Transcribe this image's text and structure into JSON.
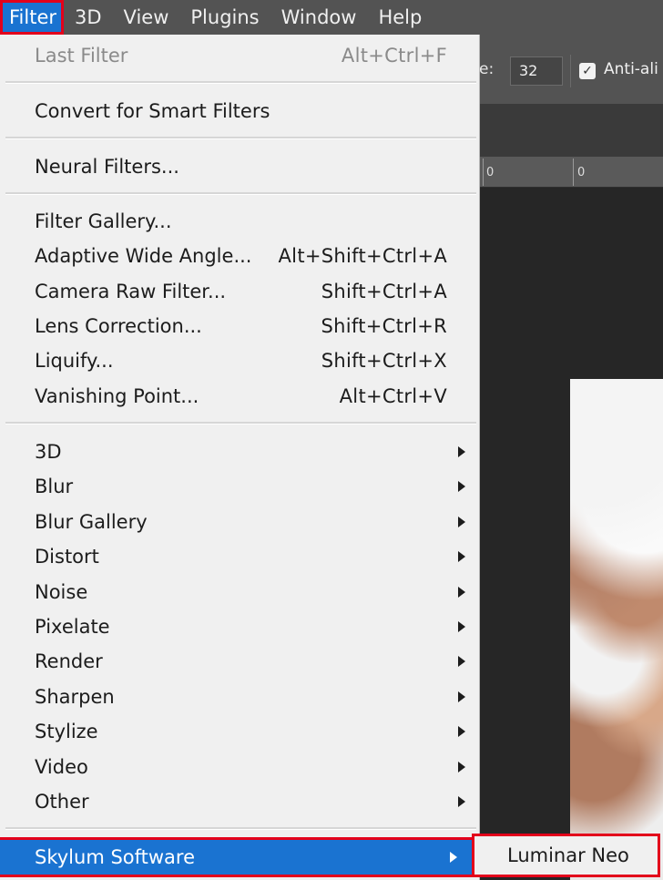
{
  "menubar": {
    "items": [
      {
        "label": "Filter"
      },
      {
        "label": "3D"
      },
      {
        "label": "View"
      },
      {
        "label": "Plugins"
      },
      {
        "label": "Window"
      },
      {
        "label": "Help"
      }
    ]
  },
  "options_bar": {
    "size_label": "e:",
    "size_value": "32",
    "anti_alias_checked": true,
    "anti_alias_label": "Anti-ali"
  },
  "ruler": {
    "labels": [
      "0",
      "0"
    ]
  },
  "filter_menu": {
    "last_filter": {
      "label": "Last Filter",
      "shortcut": "Alt+Ctrl+F"
    },
    "convert_smart": {
      "label": "Convert for Smart Filters"
    },
    "neural_filters": {
      "label": "Neural Filters..."
    },
    "filter_gallery": {
      "label": "Filter Gallery..."
    },
    "adaptive_wide_angle": {
      "label": "Adaptive Wide Angle...",
      "shortcut": "Alt+Shift+Ctrl+A"
    },
    "camera_raw": {
      "label": "Camera Raw Filter...",
      "shortcut": "Shift+Ctrl+A"
    },
    "lens_correction": {
      "label": "Lens Correction...",
      "shortcut": "Shift+Ctrl+R"
    },
    "liquify": {
      "label": "Liquify...",
      "shortcut": "Shift+Ctrl+X"
    },
    "vanishing_point": {
      "label": "Vanishing Point...",
      "shortcut": "Alt+Ctrl+V"
    },
    "submenus": [
      {
        "label": "3D"
      },
      {
        "label": "Blur"
      },
      {
        "label": "Blur Gallery"
      },
      {
        "label": "Distort"
      },
      {
        "label": "Noise"
      },
      {
        "label": "Pixelate"
      },
      {
        "label": "Render"
      },
      {
        "label": "Sharpen"
      },
      {
        "label": "Stylize"
      },
      {
        "label": "Video"
      },
      {
        "label": "Other"
      }
    ],
    "skylum": {
      "label": "Skylum Software"
    }
  },
  "skylum_submenu": {
    "items": [
      {
        "label": "Luminar Neo"
      }
    ]
  },
  "colors": {
    "highlight": "#1a73d1",
    "annotation_red": "#e3001b",
    "menu_bg": "#f0f0f0",
    "menubar_bg": "#535353"
  }
}
